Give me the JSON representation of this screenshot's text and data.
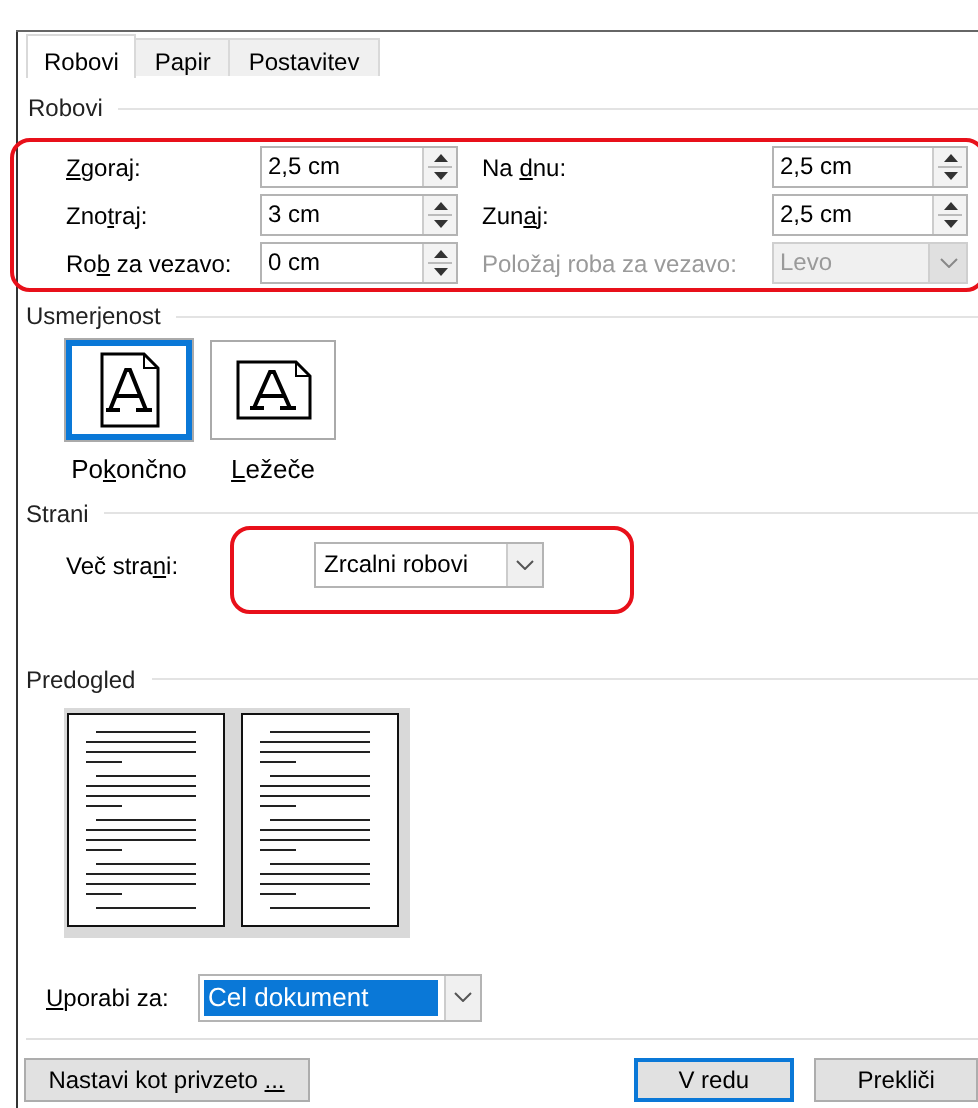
{
  "tabs": [
    {
      "label": "Robovi",
      "selected": true
    },
    {
      "label": "Papir",
      "selected": false
    },
    {
      "label": "Postavitev",
      "selected": false
    }
  ],
  "margins": {
    "heading": "Robovi",
    "highlighted": true,
    "fields": [
      {
        "label": {
          "key": "Z",
          "after": "goraj:"
        },
        "value": "2,5 cm",
        "kind": "spinner",
        "disabled": false
      },
      {
        "label": {
          "before": "Na ",
          "key": "d",
          "after": "nu:"
        },
        "value": "2,5 cm",
        "kind": "spinner",
        "disabled": false
      },
      {
        "label": {
          "before": "Zno",
          "key": "t",
          "after": "raj:"
        },
        "value": "3 cm",
        "kind": "spinner",
        "disabled": false
      },
      {
        "label": {
          "before": "Zun",
          "key": "a",
          "after": "j:"
        },
        "value": "2,5 cm",
        "kind": "spinner",
        "disabled": false
      },
      {
        "label": {
          "before": "Ro",
          "key": "b",
          "after": " za vezavo:"
        },
        "value": "0 cm",
        "kind": "spinner",
        "disabled": false
      },
      {
        "label": {
          "before": "Položaj roba za vezavo:"
        },
        "value": "Levo",
        "kind": "dropdown",
        "disabled": true
      }
    ]
  },
  "orientation": {
    "heading": "Usmerjenost",
    "options": [
      {
        "label": {
          "before": "Po",
          "key": "k",
          "after": "ončno"
        },
        "kind": "portrait",
        "selected": true
      },
      {
        "label": {
          "key": "L",
          "after": "ežeče"
        },
        "kind": "landscape",
        "selected": false
      }
    ]
  },
  "pages": {
    "heading": "Strani",
    "highlighted": true,
    "label": {
      "before": "Več stra",
      "key": "n",
      "after": "i:"
    },
    "value": "Zrcalni robovi"
  },
  "preview": {
    "heading": "Predogled"
  },
  "apply_to": {
    "label": {
      "key": "U",
      "after": "porabi za:"
    },
    "value": "Cel dokument"
  },
  "buttons": [
    {
      "label": {
        "before": "Nastavi kot privzeto ",
        "key": "..."
      },
      "kind": "default"
    },
    {
      "label": {
        "before": "V redu"
      },
      "kind": "primary"
    },
    {
      "label": {
        "before": "Prekliči"
      },
      "kind": "default"
    }
  ]
}
